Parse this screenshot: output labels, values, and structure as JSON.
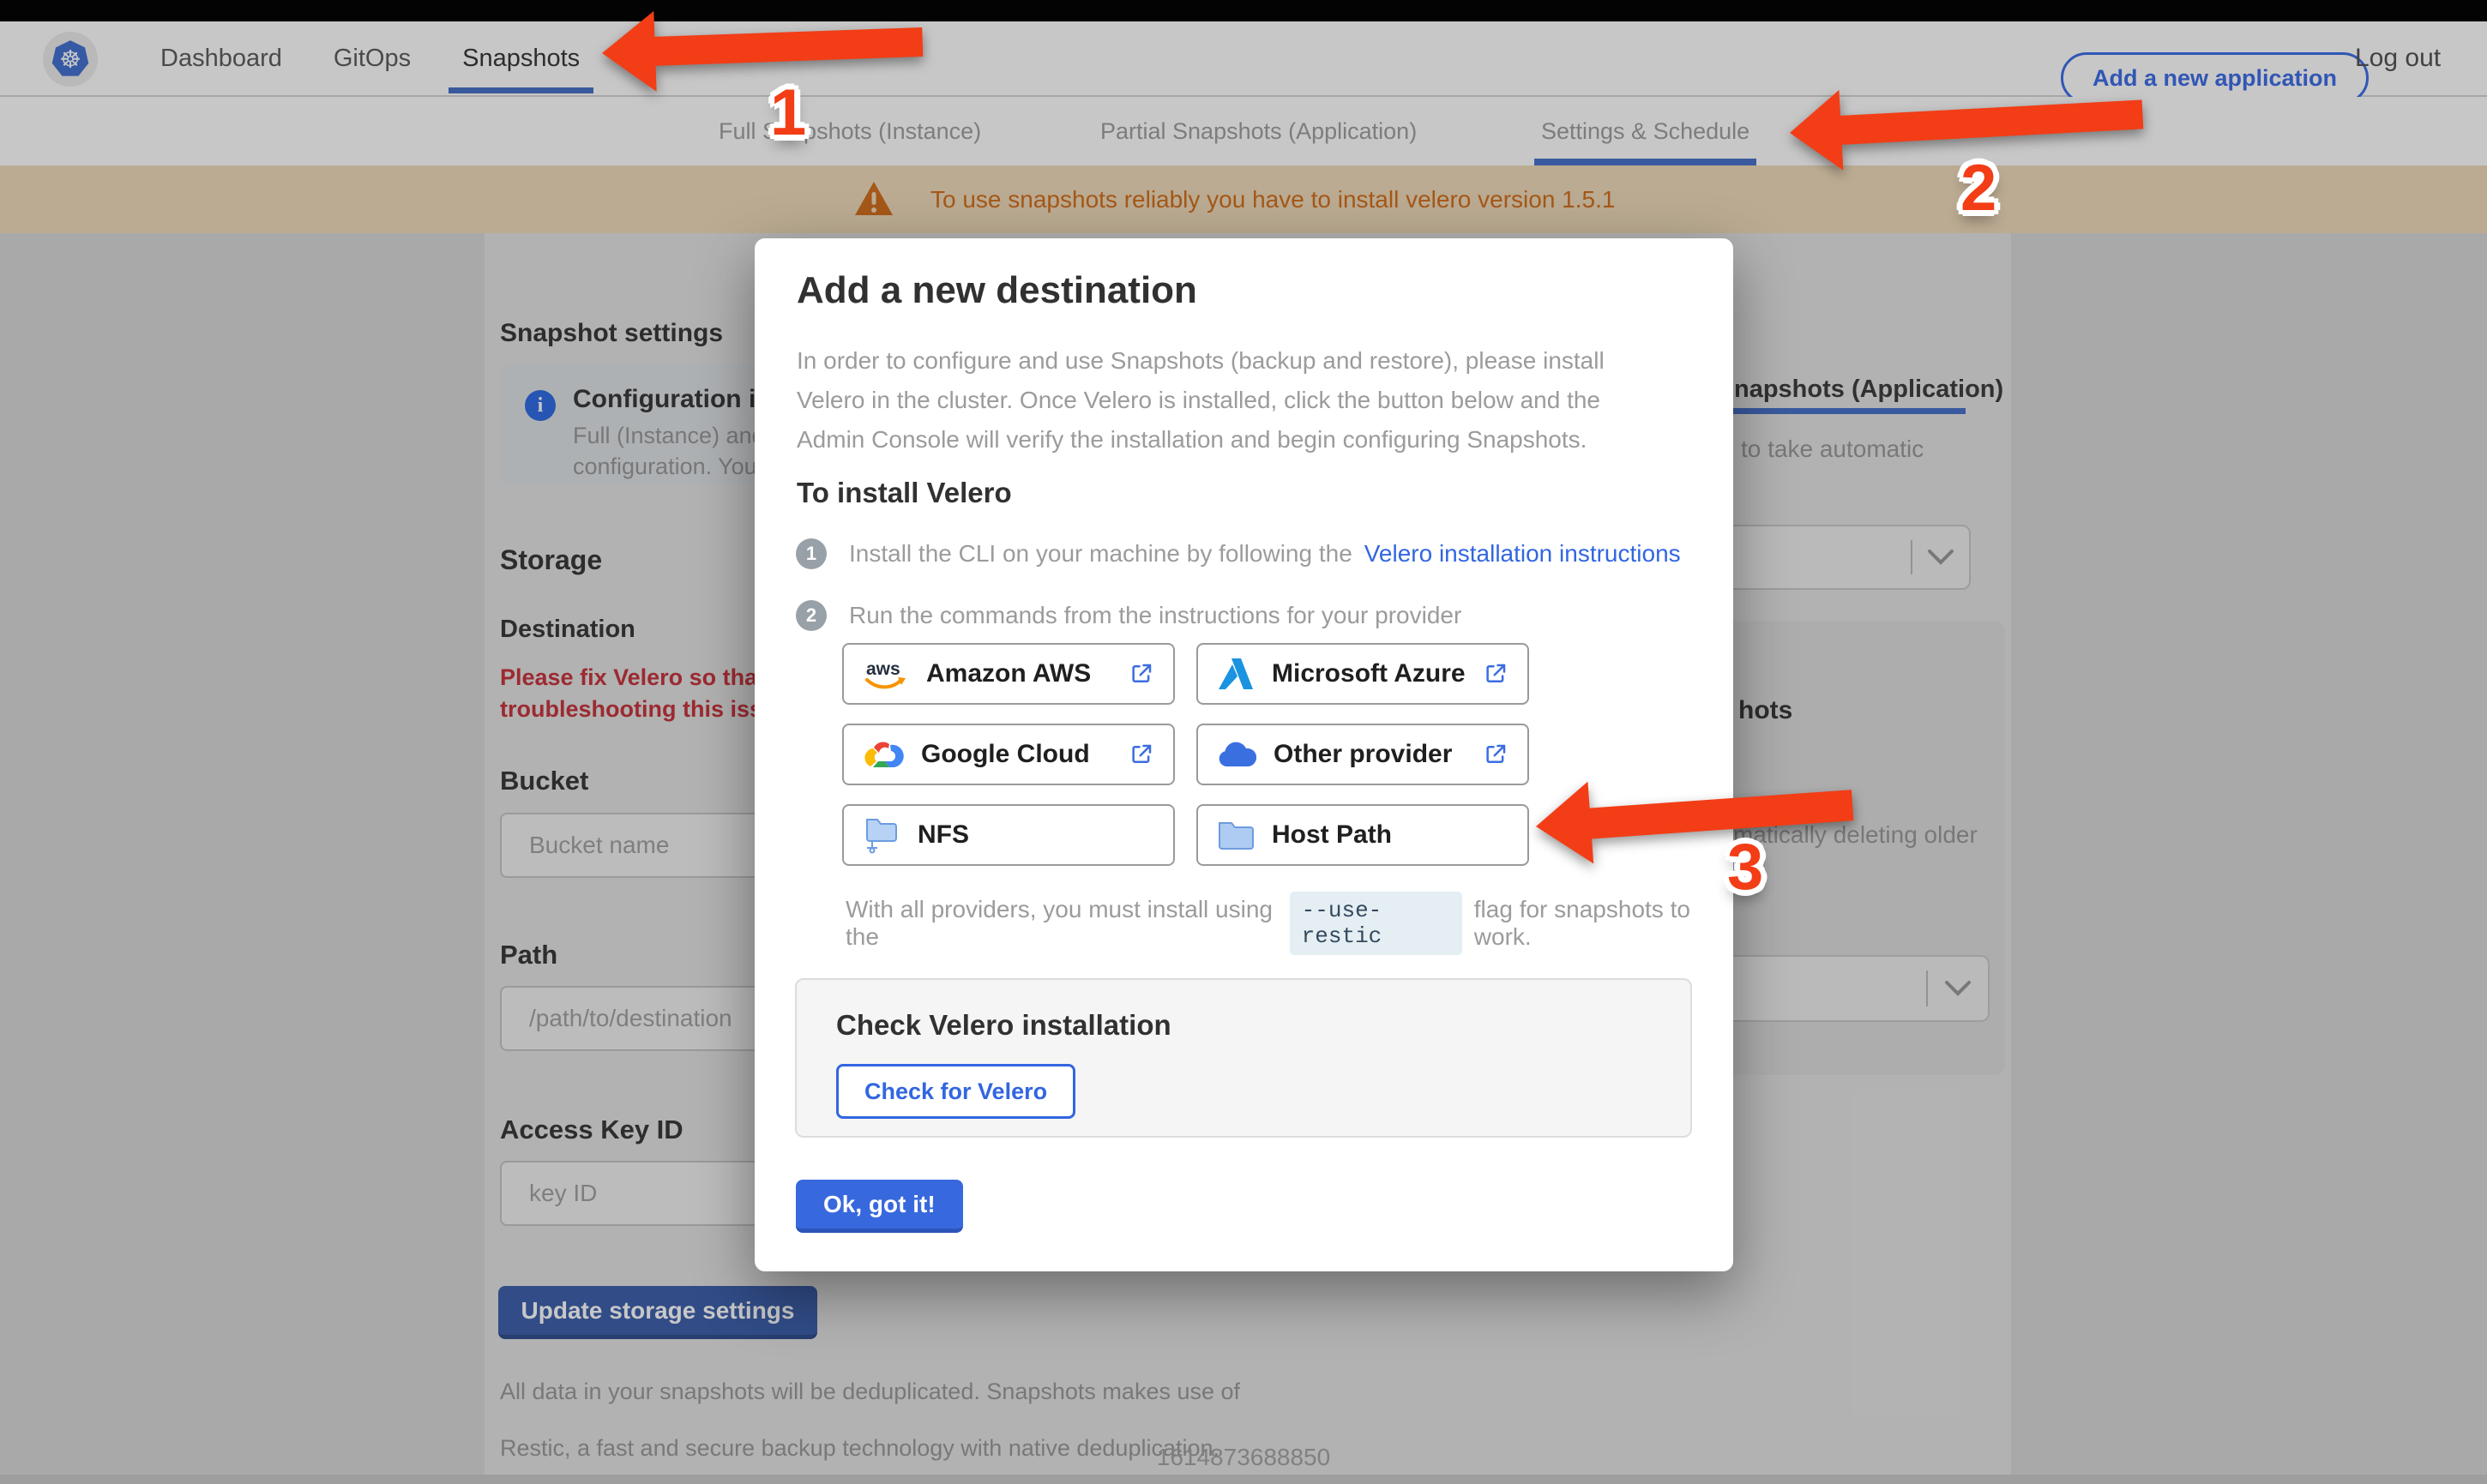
{
  "colors": {
    "accent_blue": "#326de6",
    "link_blue": "#3266e0",
    "arrow_red": "#f23d16",
    "error_red": "#c8373f",
    "banner_orange": "#d4711f"
  },
  "topnav": {
    "brand_icon": "kubernetes-logo",
    "items": [
      {
        "label": "Dashboard"
      },
      {
        "label": "GitOps"
      },
      {
        "label": "Snapshots"
      }
    ],
    "active_item": "Snapshots",
    "add_app_label": "Add a new application",
    "logout_label": "Log out"
  },
  "subnav": {
    "tabs": [
      {
        "label": "Full Snapshots (Instance)"
      },
      {
        "label": "Partial Snapshots (Application)"
      },
      {
        "label": "Settings & Schedule"
      }
    ],
    "active_tab": "Settings & Schedule"
  },
  "banner": {
    "text": "To use snapshots reliably you have to install velero version 1.5.1"
  },
  "settings_page": {
    "title": "Snapshot settings",
    "info_box": {
      "title": "Configuration is sh",
      "line1": "Full (Instance) and Parti",
      "line2": "configuration. Your stor"
    },
    "storage_heading": "Storage",
    "destination_label": "Destination",
    "error_line1": "Please fix Velero so that th",
    "error_line2": "troubleshooting this issue",
    "bucket_label": "Bucket",
    "bucket_placeholder": "Bucket name",
    "path_label": "Path",
    "path_placeholder": "/path/to/destination",
    "access_key_label": "Access Key ID",
    "access_key_placeholder": "key ID",
    "update_button": "Update storage settings",
    "dedup_line1": "All data in your snapshots will be deduplicated. Snapshots makes use of",
    "dedup_line2": "Restic, a fast and secure backup technology with native deduplication.",
    "right_tab_fragment": "napshots (Application)",
    "right_text1": "to take automatic",
    "right_heading_fragment": "hots",
    "right_text2": "matically deleting older"
  },
  "modal": {
    "title": "Add a new destination",
    "description": "In order to configure and use Snapshots (backup and restore), please install Velero in the cluster. Once Velero is installed, click the button below and the Admin Console will verify the installation and begin configuring Snapshots.",
    "install_heading": "To install Velero",
    "steps": [
      {
        "number": "1",
        "text": "Install the CLI on your machine by following the",
        "link": "Velero installation instructions"
      },
      {
        "number": "2",
        "text": "Run the commands from the instructions for your provider"
      }
    ],
    "providers": [
      {
        "label": "Amazon AWS",
        "icon": "aws-icon",
        "external": true
      },
      {
        "label": "Microsoft Azure",
        "icon": "azure-icon",
        "external": true
      },
      {
        "label": "Google Cloud",
        "icon": "google-cloud-icon",
        "external": true
      },
      {
        "label": "Other provider",
        "icon": "cloud-icon",
        "external": true
      },
      {
        "label": "NFS",
        "icon": "nfs-folder-icon",
        "external": false
      },
      {
        "label": "Host Path",
        "icon": "folder-icon",
        "external": false
      }
    ],
    "restic_note_prefix": "With all providers, you must install using the",
    "restic_code": "--use-restic",
    "restic_note_suffix": "flag for snapshots to work.",
    "check_section": {
      "title": "Check Velero installation",
      "button": "Check for Velero"
    },
    "ok_button": "Ok, got it!"
  },
  "annotations": {
    "step1": "1",
    "step2": "2",
    "step3": "3"
  },
  "footer": {
    "timestamp": "1614873688850"
  }
}
